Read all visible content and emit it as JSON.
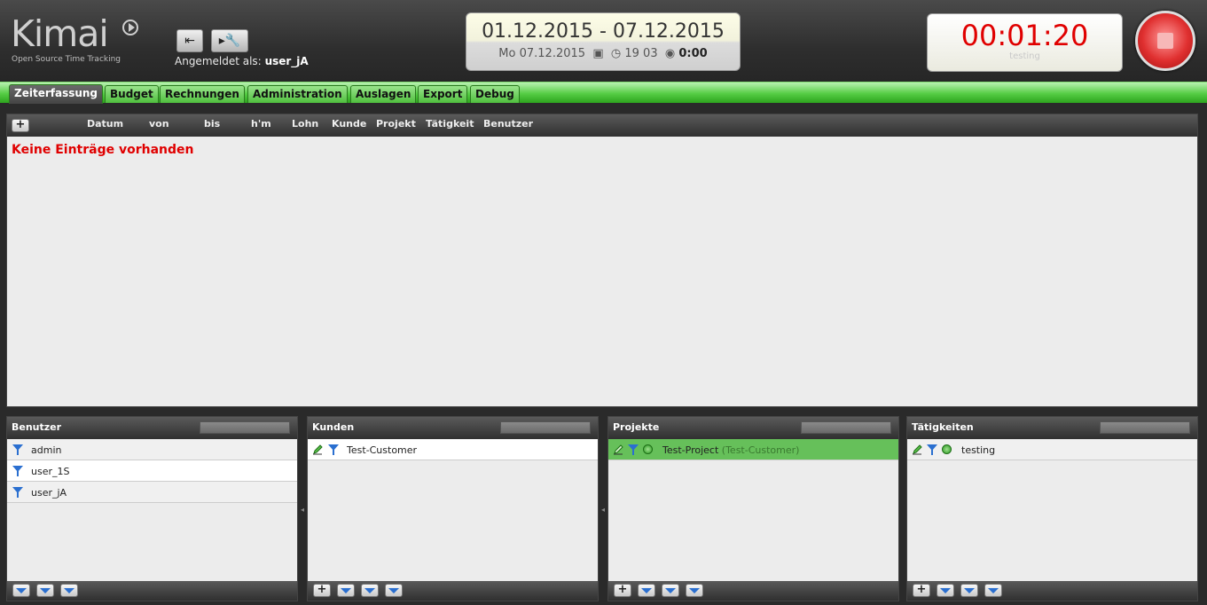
{
  "header": {
    "logo_text": "Kimai",
    "logo_subtitle": "Open Source Time Tracking",
    "login_label": "Angemeldet als:",
    "login_user": "user_jA",
    "date_range": "01.12.2015 - 07.12.2015",
    "current_date": "Mo 07.12.2015",
    "clock_time": "19 03",
    "watched_time": "0:00",
    "timer": "00:01:20",
    "timer_activity": "testing"
  },
  "tabs": [
    {
      "label": "Zeiterfassung",
      "active": true
    },
    {
      "label": "Budget"
    },
    {
      "label": "Rechnungen"
    },
    {
      "label": "Administration"
    },
    {
      "label": "Auslagen"
    },
    {
      "label": "Export"
    },
    {
      "label": "Debug"
    }
  ],
  "timesheet": {
    "add_label": "+",
    "columns": [
      "Datum",
      "von",
      "bis",
      "h'm",
      "Lohn",
      "Kunde",
      "Projekt",
      "Tätigkeit",
      "Benutzer"
    ],
    "empty_message": "Keine Einträge vorhanden"
  },
  "panels": {
    "users": {
      "title": "Benutzer",
      "items": [
        "admin",
        "user_1S",
        "user_jA"
      ]
    },
    "customers": {
      "title": "Kunden",
      "items": [
        "Test-Customer"
      ]
    },
    "projects": {
      "title": "Projekte",
      "items": [
        {
          "name": "Test-Project",
          "customer": "(Test-Customer)"
        }
      ]
    },
    "activities": {
      "title": "Tätigkeiten",
      "items": [
        "testing"
      ]
    }
  },
  "colors": {
    "accent_green": "#55cc44",
    "timer_red": "#e00000",
    "empty_red": "#e00000",
    "selected_row": "#66c05a"
  }
}
